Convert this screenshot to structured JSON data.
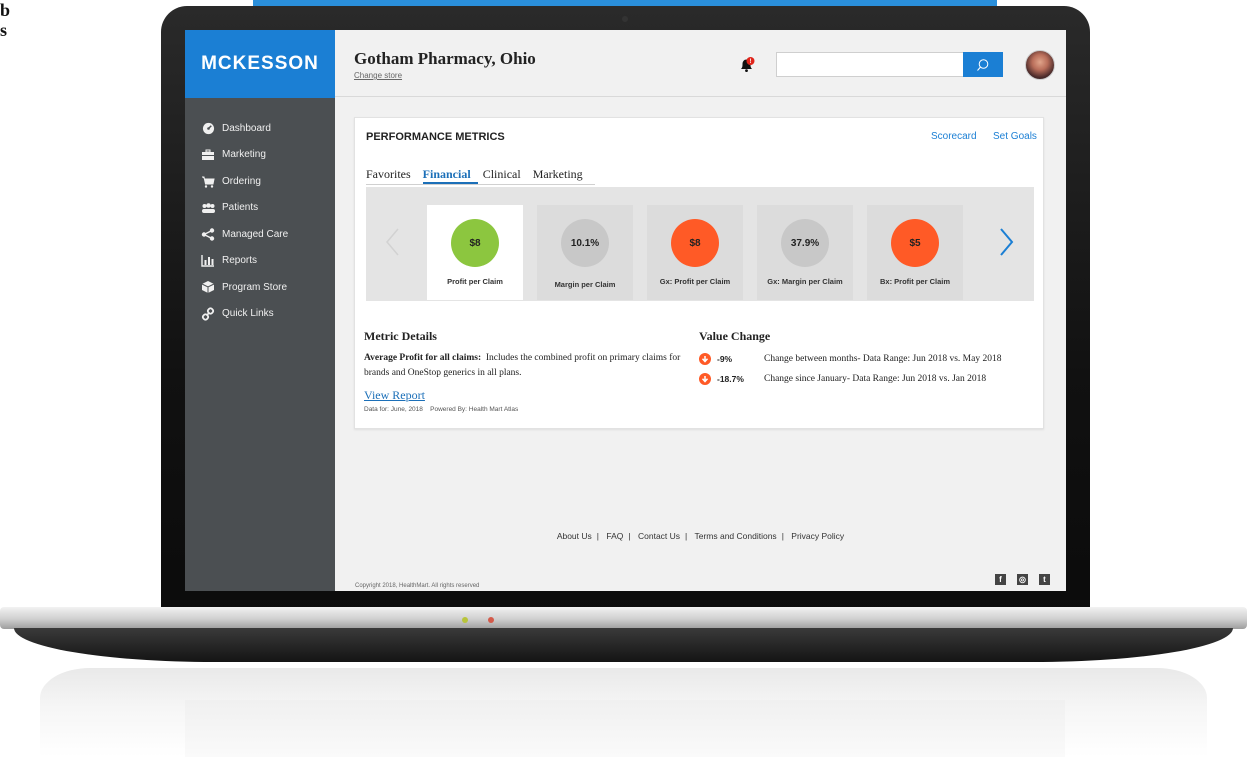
{
  "edge_text": "b s",
  "sidebar": {
    "brand": "MCKESSON",
    "items": [
      {
        "label": "Dashboard",
        "icon": "dashboard-icon"
      },
      {
        "label": "Marketing",
        "icon": "briefcase-icon"
      },
      {
        "label": "Ordering",
        "icon": "cart-icon"
      },
      {
        "label": "Patients",
        "icon": "people-icon"
      },
      {
        "label": "Managed Care",
        "icon": "share-icon"
      },
      {
        "label": "Reports",
        "icon": "bar-chart-icon"
      },
      {
        "label": "Program Store",
        "icon": "box-icon"
      },
      {
        "label": "Quick Links",
        "icon": "link-icon"
      }
    ]
  },
  "header": {
    "store_name": "Gotham Pharmacy, Ohio",
    "change_store": "Change store",
    "notification_count": "!",
    "search": {
      "value": "",
      "placeholder": ""
    }
  },
  "metrics_card": {
    "title": "PERFORMANCE METRICS",
    "links": {
      "scorecard": "Scorecard",
      "set_goals": "Set Goals"
    },
    "tabs": [
      {
        "label": "Favorites",
        "active": false
      },
      {
        "label": "Financial",
        "active": true
      },
      {
        "label": "Clinical",
        "active": false
      },
      {
        "label": "Marketing",
        "active": false
      }
    ],
    "metrics": [
      {
        "value": "$8",
        "label": "Profit per Claim",
        "color": "#8cc63f",
        "selected": true
      },
      {
        "value": "10.1%",
        "label": "Margin per Claim",
        "color": "#c8c8c8",
        "selected": false
      },
      {
        "value": "$8",
        "label": "Gx: Profit per Claim",
        "color": "#ff5a26",
        "selected": false
      },
      {
        "value": "37.9%",
        "label": "Gx: Margin per Claim",
        "color": "#c8c8c8",
        "selected": false
      },
      {
        "value": "$5",
        "label": "Bx: Profit per Claim",
        "color": "#ff5a26",
        "selected": false
      }
    ],
    "details": {
      "title": "Metric Details",
      "lead": "Average Profit for all claims:",
      "text": "Includes the combined profit on primary claims for brands and OneStop generics in all plans.",
      "view_report": "View Report",
      "data_for": "Data for: June, 2018",
      "powered_by": "Powered By: Health Mart Atlas"
    },
    "value_change": {
      "title": "Value Change",
      "rows": [
        {
          "value": "-9%",
          "description": "Change between months- Data Range: Jun 2018 vs. May 2018"
        },
        {
          "value": "-18.7%",
          "description": "Change since January- Data Range: Jun 2018 vs. Jan 2018"
        }
      ]
    }
  },
  "footer": {
    "links": [
      "About Us",
      "FAQ",
      "Contact Us",
      "Terms and Conditions",
      "Privacy Policy"
    ],
    "copyright": "Copyright 2018, HealthMart. All rights reserved",
    "social": [
      {
        "icon": "facebook-icon",
        "glyph": "f"
      },
      {
        "icon": "instagram-icon",
        "glyph": "◎"
      },
      {
        "icon": "twitter-icon",
        "glyph": "t"
      }
    ]
  },
  "colors": {
    "brand_blue": "#1b7fd4",
    "sidebar_bg": "#4b4f52",
    "alert_orange": "#ff5a26",
    "good_green": "#8cc63f"
  }
}
